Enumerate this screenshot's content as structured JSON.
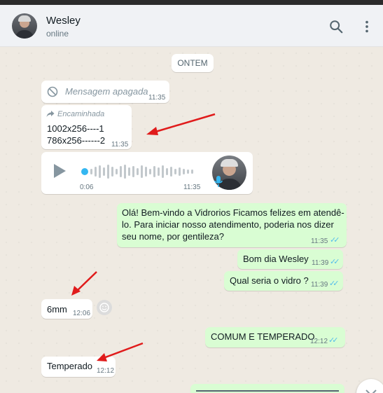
{
  "contact": {
    "name": "Wesley",
    "status": "online"
  },
  "icons": {
    "search": "search-icon",
    "menu": "kebab-menu-icon"
  },
  "colors": {
    "outgoing_bubble": "#d9fdd3",
    "incoming_bubble": "#ffffff",
    "read_ticks": "#53bdeb",
    "arrow": "#e01b1b"
  },
  "chat": {
    "date_divider": "ONTEM",
    "deleted": {
      "text": "Mensagem apagada",
      "time": "11:35"
    },
    "forwarded": {
      "label": "Encaminhada",
      "line1": "1002x256----1",
      "line2": "786x256------2",
      "time": "11:35"
    },
    "voice": {
      "duration": "0:06",
      "time": "11:35"
    },
    "welcome": {
      "line1": "Olá! Bem-vindo a Vidrorios Ficamos felizes em atendê-",
      "line2": "lo. Para iniciar nosso atendimento, poderia nos dizer",
      "line3": "seu nome, por gentileza?",
      "time": "11:35"
    },
    "greeting": {
      "text": "Bom dia Wesley",
      "time": "11:39"
    },
    "question": {
      "text": "Qual seria o vidro ?",
      "time": "11:39"
    },
    "answer1": {
      "text": "6mm",
      "time": "12:06"
    },
    "reply": {
      "text": "COMUM E TEMPERADO",
      "time": "12:12"
    },
    "answer2": {
      "text": "Temperado",
      "time": "12:12"
    }
  }
}
